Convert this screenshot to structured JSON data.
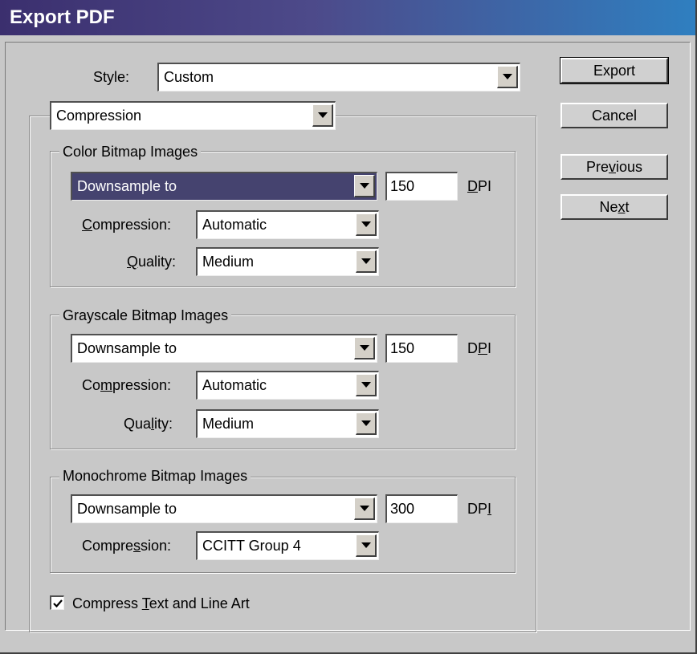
{
  "title": "Export PDF",
  "style_label": "Style:",
  "style_value": "Custom",
  "panel_select": "Compression",
  "buttons": {
    "export": "Export",
    "cancel": "Cancel",
    "previous": "Previous",
    "next": "Next"
  },
  "color": {
    "legend": "Color Bitmap Images",
    "sampling": "Downsample to",
    "dpi_value": "150",
    "dpi_unit": "DPI",
    "compression_label": "Compression:",
    "compression_value": "Automatic",
    "quality_label": "Quality:",
    "quality_value": "Medium"
  },
  "gray": {
    "legend": "Grayscale Bitmap Images",
    "sampling": "Downsample to",
    "dpi_value": "150",
    "dpi_unit": "DPI",
    "compression_label": "Compression:",
    "compression_value": "Automatic",
    "quality_label": "Quality:",
    "quality_value": "Medium"
  },
  "mono": {
    "legend": "Monochrome Bitmap Images",
    "sampling": "Downsample to",
    "dpi_value": "300",
    "dpi_unit": "DPI",
    "compression_label": "Compression:",
    "compression_value": "CCITT Group 4"
  },
  "compress_text": {
    "label": "Compress Text and Line Art",
    "checked": true
  }
}
